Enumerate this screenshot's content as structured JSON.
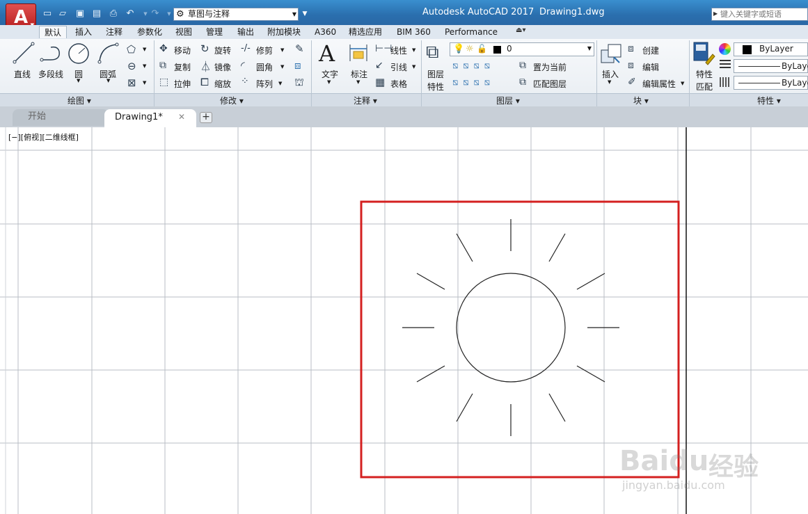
{
  "title_bar": {
    "app_title": "Autodesk AutoCAD 2017",
    "document_title": "Drawing1.dwg",
    "app_button_letter": "A",
    "workspace": "草图与注释",
    "search_placeholder": "键入关键字或短语",
    "quick_access_icons": [
      "new-icon",
      "open-icon",
      "save-icon",
      "save-as-icon",
      "plot-icon",
      "undo-icon",
      "redo-icon"
    ]
  },
  "ribbon_tabs": [
    "默认",
    "插入",
    "注释",
    "参数化",
    "视图",
    "管理",
    "输出",
    "附加模块",
    "A360",
    "精选应用",
    "BIM 360",
    "Performance"
  ],
  "active_tab": "默认",
  "panels": {
    "draw": {
      "title": "绘图",
      "line": "直线",
      "polyline": "多段线",
      "circle": "圆",
      "arc": "圆弧"
    },
    "modify": {
      "title": "修改",
      "move": "移动",
      "rotate": "旋转",
      "trim": "修剪",
      "copy": "复制",
      "mirror": "镜像",
      "fillet": "圆角",
      "stretch": "拉伸",
      "scale": "缩放",
      "array": "阵列"
    },
    "annotation": {
      "title": "注释",
      "text": "文字",
      "dimension": "标注",
      "linear": "线性",
      "leader": "引线",
      "table": "表格"
    },
    "layers": {
      "title": "图层",
      "layer_properties_line1": "图层",
      "layer_properties_line2": "特性",
      "current_layer": "0",
      "set_current": "置为当前",
      "match_layer": "匹配图层"
    },
    "block": {
      "title": "块",
      "insert": "插入",
      "create": "创建",
      "edit": "编辑",
      "edit_attributes": "编辑属性"
    },
    "properties": {
      "title": "特性",
      "match_line1": "特性",
      "match_line2": "匹配",
      "color": "ByLayer",
      "linetype": "ByLayer",
      "lineweight": "ByLayer"
    }
  },
  "document_tabs": {
    "start": "开始",
    "drawing": "Drawing1*",
    "add": "+"
  },
  "viewport_label": "[−][俯视][二维线框]",
  "watermark": {
    "brand": "Baidu",
    "brand_cn": "经验",
    "url": "jingyan.baidu.com"
  },
  "colors": {
    "title_bar": "#2a6fae",
    "highlight_box": "#d42020",
    "grid": "#b9bec4",
    "drawing_stroke": "#222222"
  }
}
